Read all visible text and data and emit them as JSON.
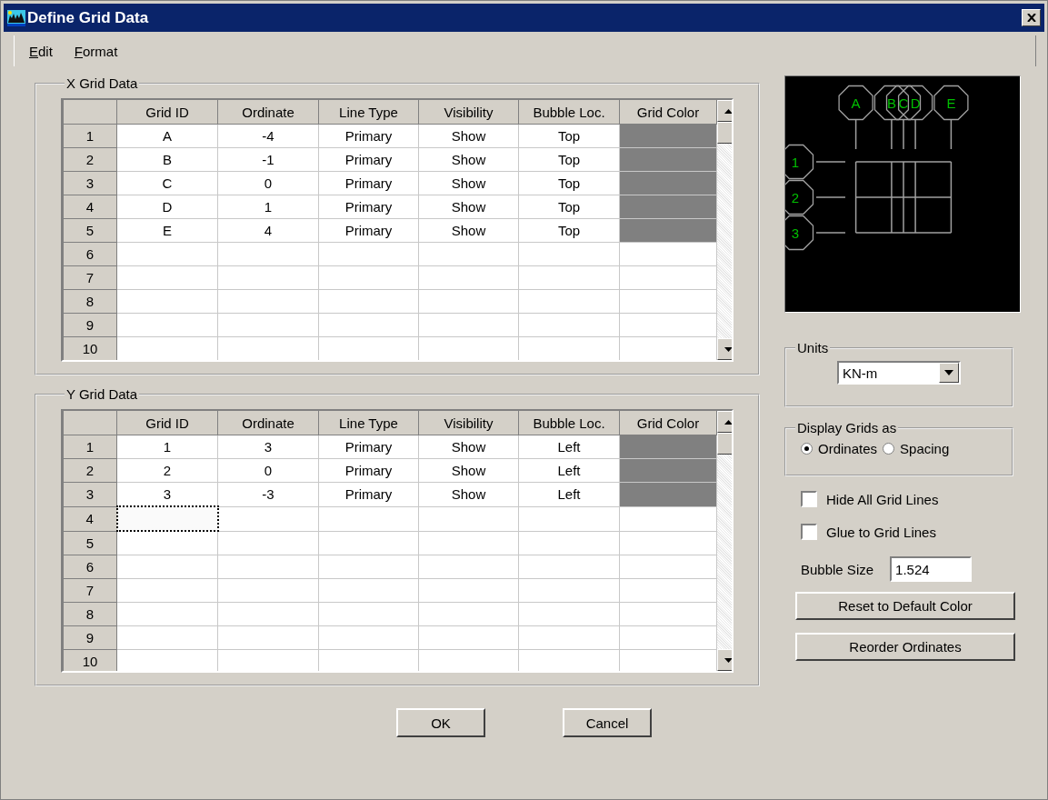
{
  "window": {
    "title": "Define Grid Data"
  },
  "menu": [
    {
      "label": "Edit"
    },
    {
      "label": "Format"
    }
  ],
  "grids": [
    {
      "title": "X Grid Data",
      "columns": [
        "Grid ID",
        "Ordinate",
        "Line Type",
        "Visibility",
        "Bubble Loc.",
        "Grid Color"
      ],
      "rows": [
        {
          "number": "1",
          "cells": [
            "A",
            "-4",
            "Primary",
            "Show",
            "Top"
          ],
          "color": "#808080",
          "focused": false
        },
        {
          "number": "2",
          "cells": [
            "B",
            "-1",
            "Primary",
            "Show",
            "Top"
          ],
          "color": "#808080",
          "focused": false
        },
        {
          "number": "3",
          "cells": [
            "C",
            "0",
            "Primary",
            "Show",
            "Top"
          ],
          "color": "#808080",
          "focused": false
        },
        {
          "number": "4",
          "cells": [
            "D",
            "1",
            "Primary",
            "Show",
            "Top"
          ],
          "color": "#808080",
          "focused": false
        },
        {
          "number": "5",
          "cells": [
            "E",
            "4",
            "Primary",
            "Show",
            "Top"
          ],
          "color": "#808080",
          "focused": false
        },
        {
          "number": "6",
          "focused": false
        },
        {
          "number": "7",
          "focused": false
        },
        {
          "number": "8",
          "focused": false
        },
        {
          "number": "9",
          "focused": false
        },
        {
          "number": "10",
          "focused": false
        }
      ]
    },
    {
      "title": "Y Grid Data",
      "columns": [
        "Grid ID",
        "Ordinate",
        "Line Type",
        "Visibility",
        "Bubble Loc.",
        "Grid Color"
      ],
      "rows": [
        {
          "number": "1",
          "cells": [
            "1",
            "3",
            "Primary",
            "Show",
            "Left"
          ],
          "color": "#808080",
          "focused": false
        },
        {
          "number": "2",
          "cells": [
            "2",
            "0",
            "Primary",
            "Show",
            "Left"
          ],
          "color": "#808080",
          "focused": false
        },
        {
          "number": "3",
          "cells": [
            "3",
            "-3",
            "Primary",
            "Show",
            "Left"
          ],
          "color": "#808080",
          "focused": false
        },
        {
          "number": "4",
          "focused": true
        },
        {
          "number": "5",
          "focused": false
        },
        {
          "number": "6",
          "focused": false
        },
        {
          "number": "7",
          "focused": false
        },
        {
          "number": "8",
          "focused": false
        },
        {
          "number": "9",
          "focused": false
        },
        {
          "number": "10",
          "focused": false
        }
      ]
    }
  ],
  "preview": {
    "x_bubbles": [
      "A",
      "B",
      "C",
      "D",
      "E"
    ],
    "y_bubbles": [
      "1",
      "2",
      "3"
    ]
  },
  "units": {
    "title": "Units",
    "value": "KN-m"
  },
  "display_grids": {
    "title": "Display Grids as",
    "options": [
      {
        "label": "Ordinates",
        "selected": true
      },
      {
        "label": "Spacing",
        "selected": false
      }
    ]
  },
  "checkboxes": [
    {
      "label": "Hide All Grid Lines",
      "checked": false
    },
    {
      "label": "Glue to Grid Lines",
      "checked": false
    }
  ],
  "bubble_size": {
    "label": "Bubble Size",
    "value": "1.524"
  },
  "side_buttons": [
    "Reset to Default Color",
    "Reorder Ordinates"
  ],
  "buttons": [
    "OK",
    "Cancel"
  ]
}
